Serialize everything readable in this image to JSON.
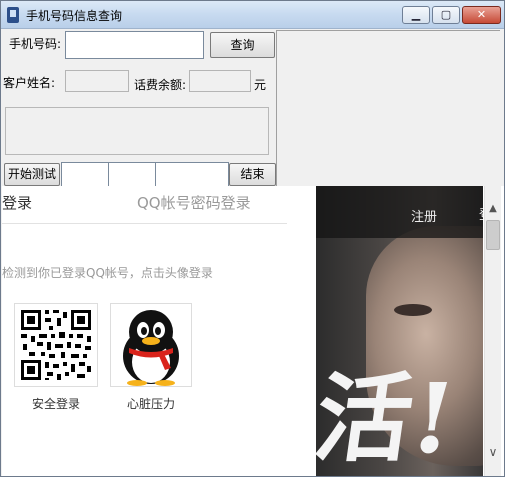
{
  "window": {
    "title": "手机号码信息查询",
    "minimize_label": "▁",
    "maximize_label": "▢",
    "close_label": "✕"
  },
  "form": {
    "phone_label": "手机号码:",
    "phone_value": "",
    "query_button": "查询",
    "customer_name_label": "客户姓名:",
    "customer_name_value": "",
    "balance_label": "话费余额:",
    "balance_value": "",
    "balance_unit": "元",
    "start_test_button": "开始测试",
    "end_button": "结束",
    "field1_value": "",
    "field2_value": "",
    "field3_value": ""
  },
  "web": {
    "tab_qr_login": "登录",
    "tab_password_login": "QQ帐号密码登录",
    "hint": "检测到你已登录QQ帐号，点击头像登录",
    "qr_caption": "安全登录",
    "avatar_caption": "心脏压力",
    "register_link": "注册",
    "banner_text": "活!",
    "partial_link": "登"
  },
  "icons": {
    "app": "app-icon",
    "qr": "qr-code-icon",
    "avatar": "qq-penguin-avatar",
    "scroll_up": "chevron-up-icon",
    "scroll_down": "chevron-down-icon"
  },
  "colors": {
    "window_bg": "#f0f0f0",
    "titlebar": "#c7daf0",
    "close_button": "#c64a36",
    "penguin_scarf": "#d9231b",
    "penguin_beak": "#f6b21b"
  }
}
